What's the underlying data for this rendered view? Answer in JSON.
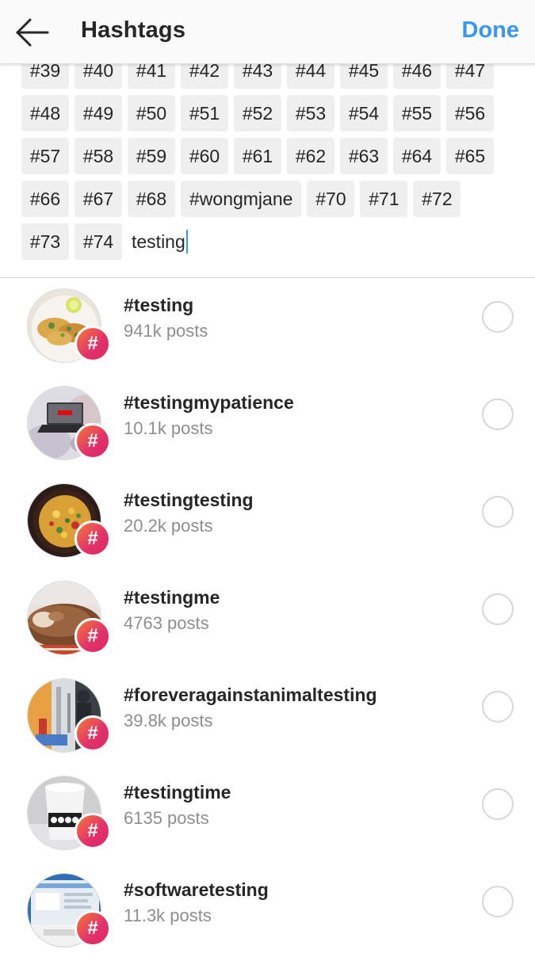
{
  "header": {
    "title": "Hashtags",
    "done_label": "Done"
  },
  "chips": {
    "rows": [
      [
        "#39",
        "#40",
        "#41",
        "#42",
        "#43",
        "#44",
        "#45",
        "#46",
        "#47"
      ],
      [
        "#48",
        "#49",
        "#50",
        "#51",
        "#52",
        "#53",
        "#54",
        "#55",
        "#56"
      ],
      [
        "#57",
        "#58",
        "#59",
        "#60",
        "#61",
        "#62",
        "#63",
        "#64",
        "#65"
      ],
      [
        "#66",
        "#67",
        "#68",
        "#wongmjane",
        "#70",
        "#71",
        "#72"
      ],
      [
        "#73",
        "#74"
      ]
    ],
    "typed_text": "testing"
  },
  "results": [
    {
      "tag": "#testing",
      "count": "941k posts"
    },
    {
      "tag": "#testingmypatience",
      "count": "10.1k posts"
    },
    {
      "tag": "#testingtesting",
      "count": "20.2k posts"
    },
    {
      "tag": "#testingme",
      "count": "4763 posts"
    },
    {
      "tag": "#foreveragainstanimaltesting",
      "count": "39.8k posts"
    },
    {
      "tag": "#testingtime",
      "count": "6135 posts"
    },
    {
      "tag": "#softwaretesting",
      "count": "11.3k posts"
    }
  ],
  "icons": {
    "back": "arrow-left-icon",
    "badge": "hashtag-badge-icon",
    "select": "radio-circle-icon"
  },
  "colors": {
    "accent": "#3897f0",
    "badge_start": "#f77737",
    "badge_end": "#e1306c",
    "muted_text": "#8e8e8e",
    "chip_bg": "#efefef"
  }
}
